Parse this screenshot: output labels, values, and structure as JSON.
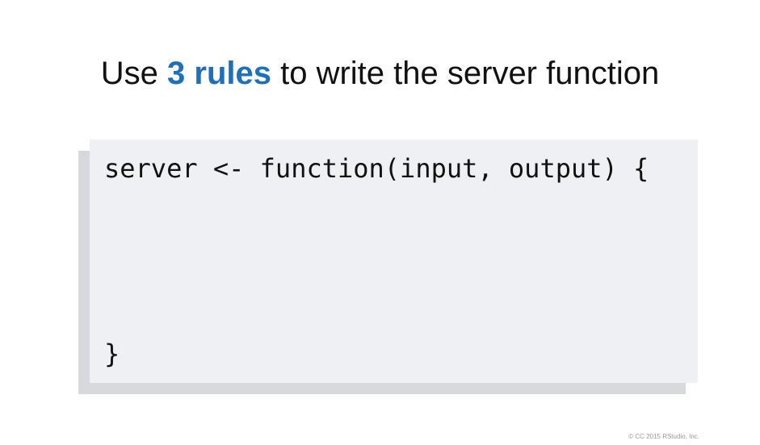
{
  "title": {
    "prefix": "Use ",
    "highlight": "3 rules",
    "suffix": " to write the server function"
  },
  "code": {
    "line1": "server <- function(input, output) {",
    "line_last": "}"
  },
  "footer": {
    "copyright": "© CC 2015 RStudio, Inc."
  },
  "colors": {
    "highlight": "#1f6fba",
    "code_background": "#eff0f4",
    "code_shadow": "#d8d9dc"
  }
}
